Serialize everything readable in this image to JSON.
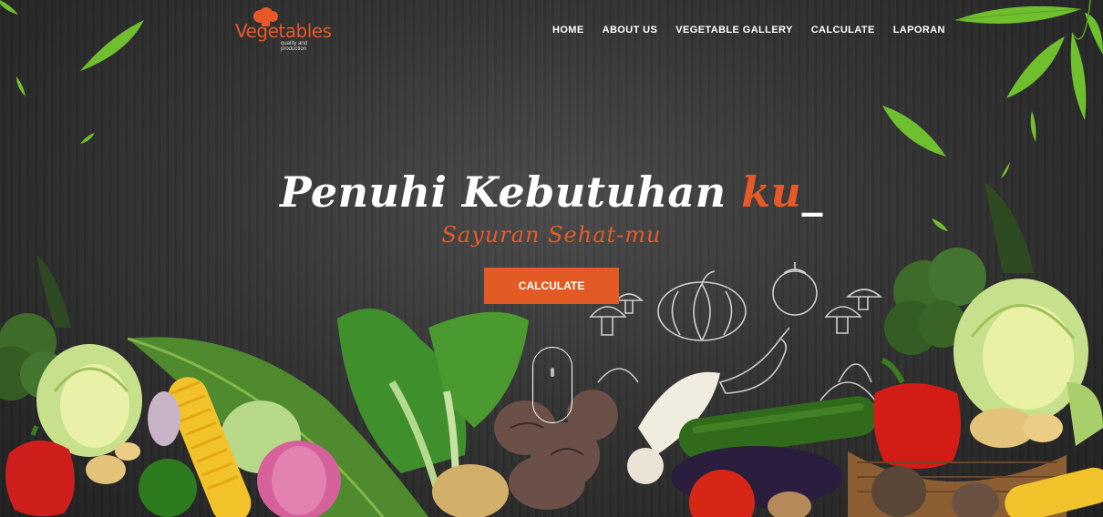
{
  "brand": {
    "name": "Vegetables",
    "tagline": "quality and production"
  },
  "nav": {
    "items": [
      {
        "label": "HOME"
      },
      {
        "label": "ABOUT US"
      },
      {
        "label": "VEGETABLE GALLERY"
      },
      {
        "label": "CALCULATE"
      },
      {
        "label": "LAPORAN"
      }
    ]
  },
  "hero": {
    "headline_main": "Penuhi Kebutuhan ",
    "headline_accent": "ku",
    "headline_cursor": "_",
    "subheadline": "Sayuran Sehat-mu",
    "cta_label": "CALCULATE"
  },
  "colors": {
    "accent": "#e35b24",
    "background": "#2e2e2e",
    "leaf": "#7dbf2a"
  }
}
